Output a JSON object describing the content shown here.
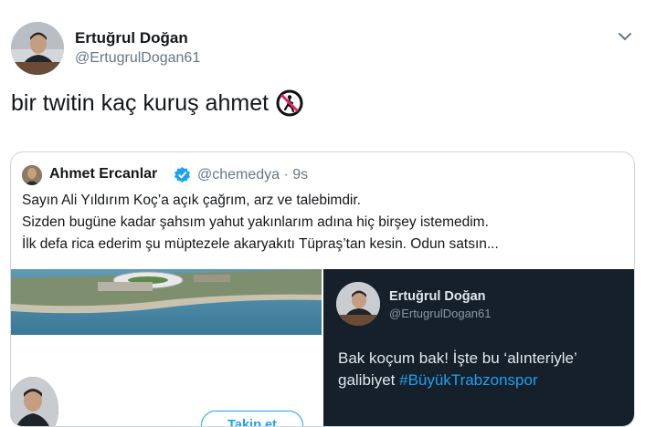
{
  "author": {
    "name": "Ertuğrul Doğan",
    "handle": "@ErtugrulDogan61"
  },
  "tweet": {
    "text": "bir twitin kaç kuruş ahmet",
    "emoji": "no-pedestrians-icon"
  },
  "menu": {
    "icon": "chevron-down-icon"
  },
  "quoted": {
    "name": "Ahmet Ercanlar",
    "verified_icon": "verified-badge-icon",
    "meta": "@chemedya · 9s",
    "lines": [
      "Sayın Ali Yıldırım Koç’a açık çağrım, arz ve talebimdir.",
      "Sizden bugüne kadar şahsım yahut yakınlarım adına hiç birşey istemedim.",
      "İlk defa rica ederim şu müptezele akaryakıtı Tüpraş’tan kesin. Odun satsın..."
    ],
    "media": {
      "left": {
        "follow_label": "Takip et"
      },
      "right": {
        "name": "Ertuğrul Doğan",
        "handle": "@ErtugrulDogan61",
        "text_line1": "Bak koçum bak! İşte bu ‘alınteriyle’",
        "text_line2_plain": "galibiyet ",
        "hashtag": "#BüyükTrabzonspor"
      }
    }
  },
  "colors": {
    "link": "#1da1f2",
    "muted": "#657786",
    "dark_bg": "#15202b"
  }
}
